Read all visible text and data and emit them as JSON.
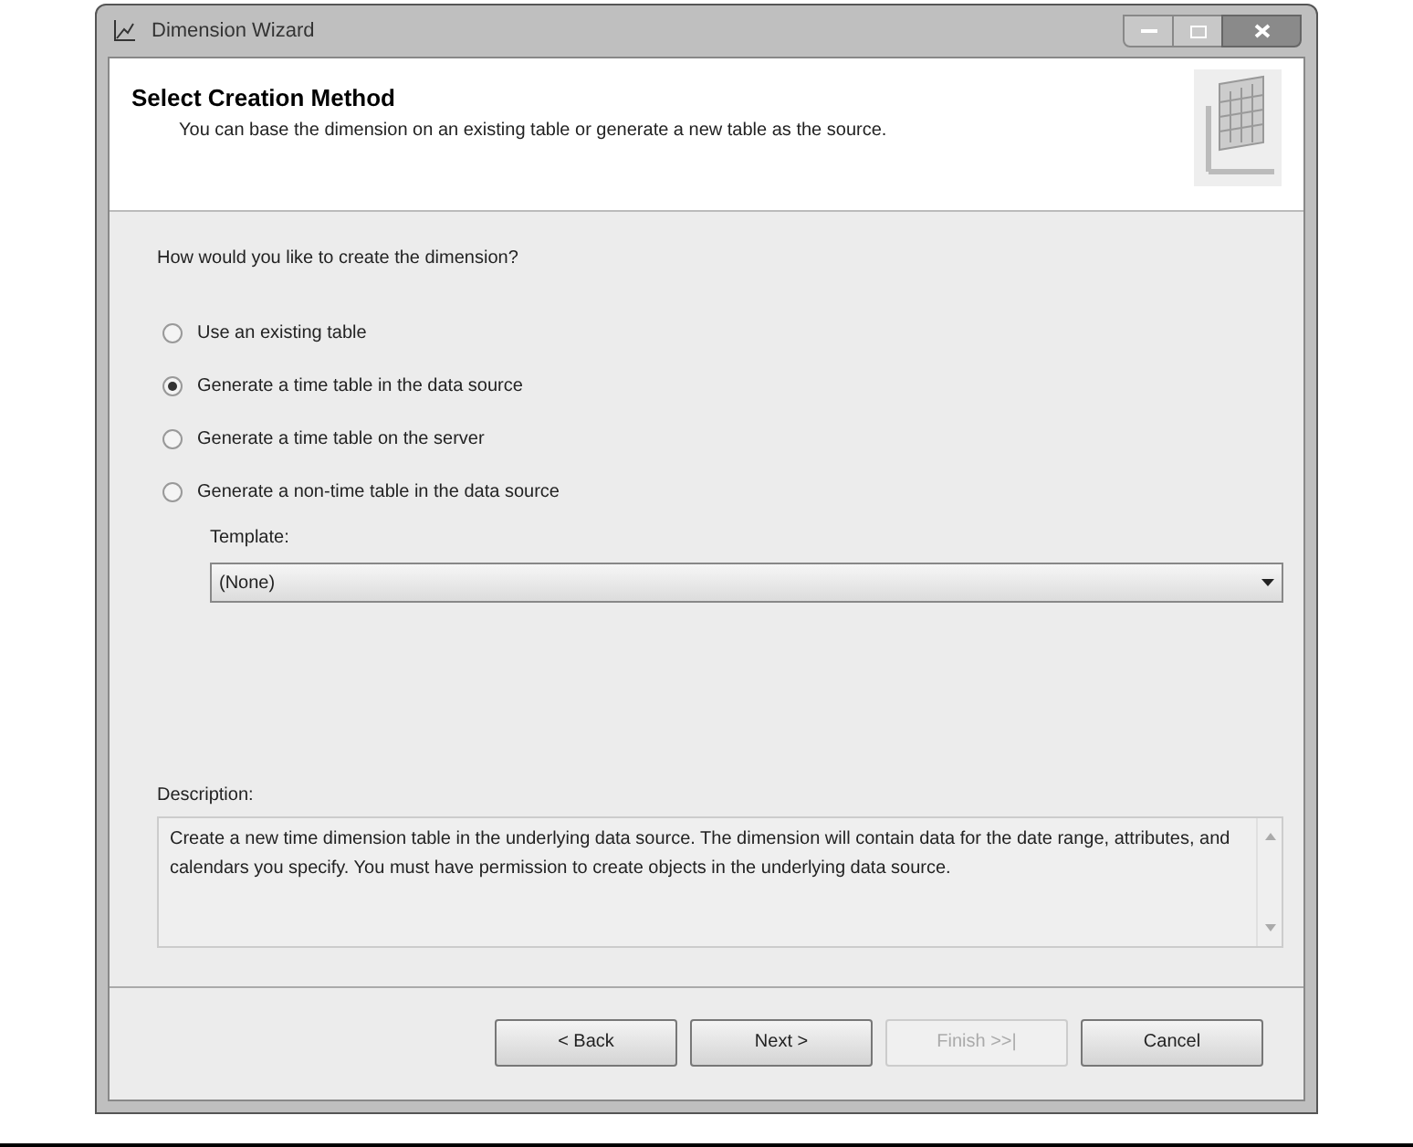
{
  "window": {
    "title": "Dimension Wizard"
  },
  "header": {
    "title": "Select Creation Method",
    "subtitle": "You can base the dimension on an existing table or generate a new table as the source."
  },
  "question": "How would you like to create the dimension?",
  "options": [
    {
      "label": "Use an existing table",
      "selected": false
    },
    {
      "label": "Generate a time table in the data source",
      "selected": true
    },
    {
      "label": "Generate a time table on the server",
      "selected": false
    },
    {
      "label": "Generate a non-time table in the data source",
      "selected": false
    }
  ],
  "template": {
    "label": "Template:",
    "value": "(None)"
  },
  "description": {
    "label": "Description:",
    "text": "Create a new time dimension table in the underlying data source. The dimension will contain data for the date range, attributes, and calendars you specify. You must have permission to create objects in the underlying data source."
  },
  "buttons": [
    {
      "label": "< Back",
      "disabled": false
    },
    {
      "label": "Next >",
      "disabled": false
    },
    {
      "label": "Finish >>|",
      "disabled": true
    },
    {
      "label": "Cancel",
      "disabled": false
    }
  ]
}
